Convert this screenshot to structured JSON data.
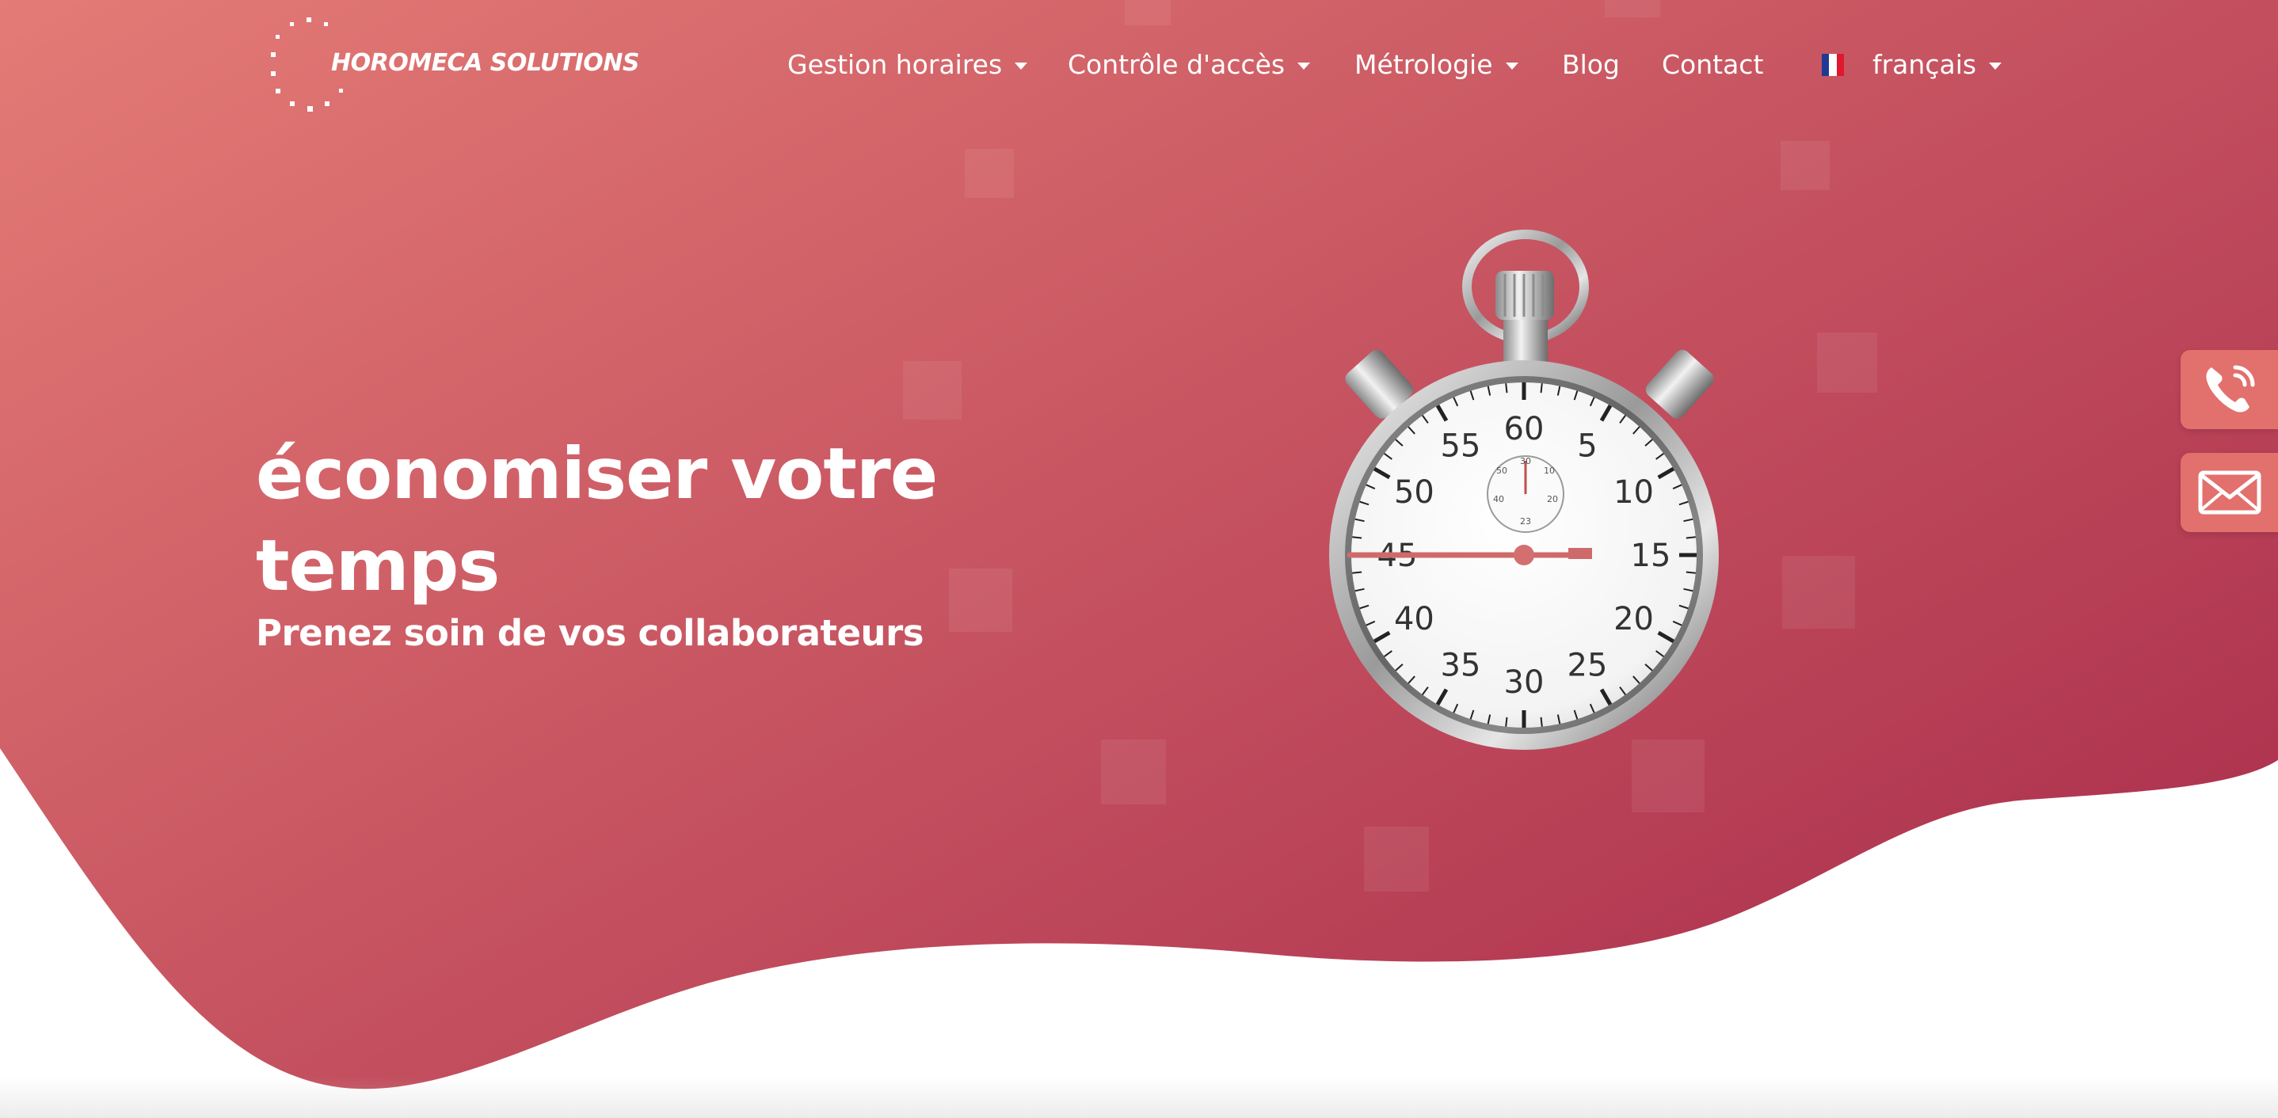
{
  "colors": {
    "hero_gradient_start": "#e47b76",
    "hero_gradient_end": "#ab2f4d",
    "side_button": "#e2706d",
    "text": "#ffffff",
    "flag_blue": "#1f3a93",
    "flag_white": "#ffffff",
    "flag_red": "#e0182d"
  },
  "logo": {
    "text": "HOROMECA SOLUTIONS",
    "icon": "dotted-circle-logo-icon"
  },
  "nav": {
    "items": [
      {
        "label": "Gestion horaires",
        "has_dropdown": true
      },
      {
        "label": "Contrôle d'accès",
        "has_dropdown": true
      },
      {
        "label": "Métrologie",
        "has_dropdown": true
      },
      {
        "label": "Blog",
        "has_dropdown": false
      },
      {
        "label": "Contact",
        "has_dropdown": false
      }
    ],
    "language": {
      "label": "français",
      "flag": "france-flag-icon",
      "has_dropdown": true
    }
  },
  "hero": {
    "title_line1": "économiser votre",
    "title_line2": "temps",
    "subtitle": "Prenez soin de vos collaborateurs",
    "image": "stopwatch-illustration"
  },
  "stopwatch": {
    "dial_numbers": [
      "60",
      "5",
      "10",
      "15",
      "20",
      "25",
      "30",
      "35",
      "40",
      "45",
      "50",
      "55"
    ],
    "subdial_numbers": [
      "30",
      "10",
      "20",
      "23",
      "40",
      "50"
    ],
    "hand_position_seconds": 15
  },
  "side_buttons": [
    {
      "icon": "phone-icon"
    },
    {
      "icon": "mail-icon"
    }
  ]
}
